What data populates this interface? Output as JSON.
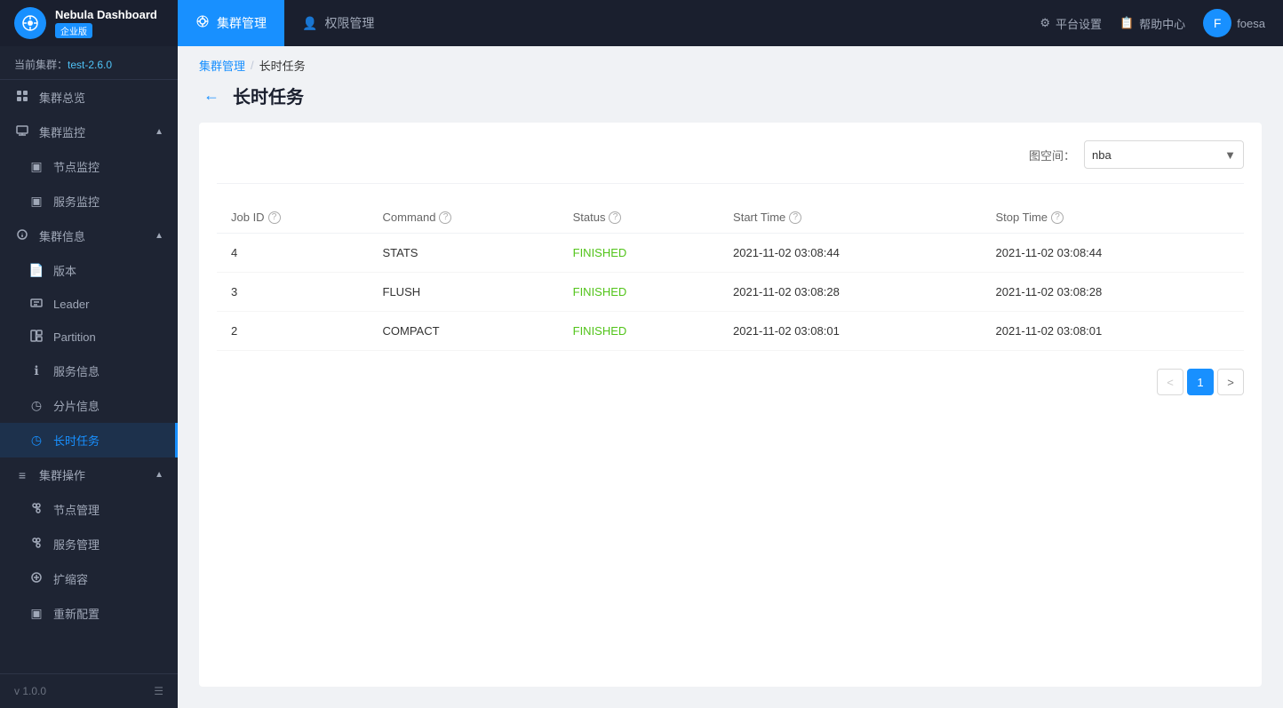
{
  "app": {
    "logo_icon": "◎",
    "logo_title": "Nebula Dashboard",
    "logo_badge": "企业版"
  },
  "top_nav": {
    "items": [
      {
        "id": "cluster-mgmt",
        "icon": "⚙",
        "label": "集群管理",
        "active": true
      },
      {
        "id": "auth-mgmt",
        "icon": "👤",
        "label": "权限管理",
        "active": false
      }
    ],
    "right_items": [
      {
        "id": "settings",
        "icon": "⚙",
        "label": "平台设置"
      },
      {
        "id": "help",
        "icon": "📋",
        "label": "帮助中心"
      }
    ],
    "user": {
      "name": "foesa",
      "avatar_letter": "F"
    }
  },
  "sidebar": {
    "cluster_label": "当前集群：",
    "cluster_name": "test-2.6.0",
    "sections": [
      {
        "id": "cluster-overview",
        "icon": "▦",
        "label": "集群总览",
        "type": "item"
      },
      {
        "id": "cluster-monitor",
        "icon": "▤",
        "label": "集群监控",
        "type": "section",
        "expanded": true,
        "children": [
          {
            "id": "node-monitor",
            "icon": "▣",
            "label": "节点监控"
          },
          {
            "id": "service-monitor",
            "icon": "▣",
            "label": "服务监控"
          }
        ]
      },
      {
        "id": "cluster-info",
        "icon": "◈",
        "label": "集群信息",
        "type": "section",
        "expanded": true,
        "children": [
          {
            "id": "version",
            "icon": "📄",
            "label": "版本"
          },
          {
            "id": "leader",
            "icon": "▦",
            "label": "Leader"
          },
          {
            "id": "partition",
            "icon": "▦",
            "label": "Partition"
          },
          {
            "id": "service-info",
            "icon": "ℹ",
            "label": "服务信息"
          },
          {
            "id": "shard-info",
            "icon": "◷",
            "label": "分片信息"
          },
          {
            "id": "long-task",
            "icon": "◷",
            "label": "长时任务",
            "active": true
          }
        ]
      },
      {
        "id": "cluster-ops",
        "icon": "≡",
        "label": "集群操作",
        "type": "section",
        "expanded": true,
        "children": [
          {
            "id": "node-mgmt",
            "icon": "⚙",
            "label": "节点管理"
          },
          {
            "id": "service-mgmt",
            "icon": "⚙",
            "label": "服务管理"
          },
          {
            "id": "scale",
            "icon": "⚙",
            "label": "扩缩容"
          },
          {
            "id": "reconfig",
            "icon": "▣",
            "label": "重新配置"
          }
        ]
      }
    ],
    "version": "v 1.0.0"
  },
  "breadcrumb": {
    "parent": "集群管理",
    "separator": "/",
    "current": "长时任务"
  },
  "page": {
    "title": "长时任务",
    "back_label": "←"
  },
  "toolbar": {
    "namespace_label": "图空间：",
    "namespace_value": "nba",
    "namespace_options": [
      "nba"
    ]
  },
  "table": {
    "columns": [
      {
        "id": "job-id",
        "label": "Job ID",
        "has_help": true
      },
      {
        "id": "command",
        "label": "Command",
        "has_help": true
      },
      {
        "id": "status",
        "label": "Status",
        "has_help": true
      },
      {
        "id": "start-time",
        "label": "Start Time",
        "has_help": true
      },
      {
        "id": "stop-time",
        "label": "Stop Time",
        "has_help": true
      }
    ],
    "rows": [
      {
        "job_id": "4",
        "command": "STATS",
        "status": "FINISHED",
        "start_time": "2021-11-02 03:08:44",
        "stop_time": "2021-11-02 03:08:44"
      },
      {
        "job_id": "3",
        "command": "FLUSH",
        "status": "FINISHED",
        "start_time": "2021-11-02 03:08:28",
        "stop_time": "2021-11-02 03:08:28"
      },
      {
        "job_id": "2",
        "command": "COMPACT",
        "status": "FINISHED",
        "start_time": "2021-11-02 03:08:01",
        "stop_time": "2021-11-02 03:08:01"
      }
    ]
  },
  "pagination": {
    "prev_label": "<",
    "next_label": ">",
    "current_page": 1,
    "pages": [
      1
    ]
  }
}
